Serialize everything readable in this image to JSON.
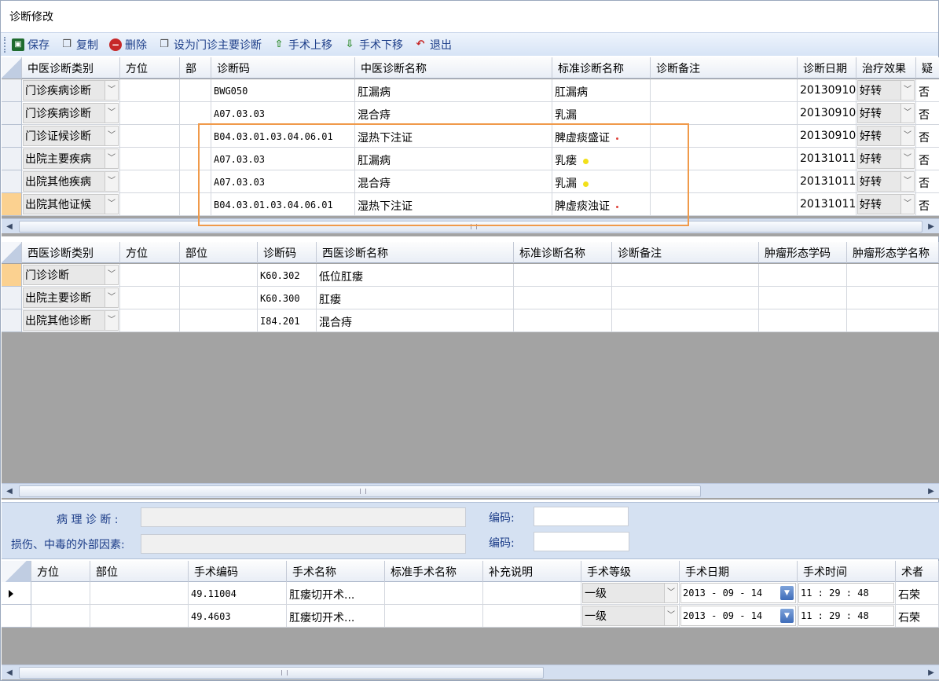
{
  "window": {
    "title": "诊断修改"
  },
  "toolbar": [
    {
      "label": "保存",
      "icon": "save-icon"
    },
    {
      "label": "复制",
      "icon": "copy-icon"
    },
    {
      "label": "删除",
      "icon": "delete-icon"
    },
    {
      "label": "设为门诊主要诊断",
      "icon": "set-primary-icon"
    },
    {
      "label": "手术上移",
      "icon": "arrow-up-icon"
    },
    {
      "label": "手术下移",
      "icon": "arrow-down-icon"
    },
    {
      "label": "退出",
      "icon": "exit-icon"
    }
  ],
  "tcm_grid": {
    "columns": [
      "中医诊断类别",
      "方位",
      "部",
      "诊断码",
      "中医诊断名称",
      "标准诊断名称",
      "诊断备注",
      "诊断日期",
      "治疗效果",
      "疑"
    ],
    "rows": [
      {
        "category": "门诊疾病诊断",
        "position": "",
        "part": "",
        "code": "BWG050",
        "name": "肛漏病",
        "standard": "肛漏病",
        "note": "",
        "date": "20130910",
        "effect": "好转",
        "doubt": "否",
        "dot": ""
      },
      {
        "category": "门诊疾病诊断",
        "position": "",
        "part": "",
        "code": "A07.03.03",
        "name": "混合痔",
        "standard": "乳漏",
        "note": "",
        "date": "20130910",
        "effect": "好转",
        "doubt": "否",
        "dot": ""
      },
      {
        "category": "门诊证候诊断",
        "position": "",
        "part": "",
        "code": "B04.03.01.03.04.06.01",
        "name": "湿热下注证",
        "standard": "脾虚痰盛证",
        "note": "",
        "date": "20130910",
        "effect": "好转",
        "doubt": "否",
        "dot": "#e0423a"
      },
      {
        "category": "出院主要疾病",
        "position": "",
        "part": "",
        "code": "A07.03.03",
        "name": "肛漏病",
        "standard": "乳瘘",
        "note": "",
        "date": "20131011",
        "effect": "好转",
        "doubt": "否",
        "dot": "#f2e01a"
      },
      {
        "category": "出院其他疾病",
        "position": "",
        "part": "",
        "code": "A07.03.03",
        "name": "混合痔",
        "standard": "乳漏",
        "note": "",
        "date": "20131011",
        "effect": "好转",
        "doubt": "否",
        "dot": "#f2e01a"
      },
      {
        "category": "出院其他证候",
        "position": "",
        "part": "",
        "code": "B04.03.01.03.04.06.01",
        "name": "湿热下注证",
        "standard": "脾虚痰浊证",
        "note": "",
        "date": "20131011",
        "effect": "好转",
        "doubt": "否",
        "dot": "#e0423a"
      }
    ]
  },
  "wm_grid": {
    "columns": [
      "西医诊断类别",
      "方位",
      "部位",
      "诊断码",
      "西医诊断名称",
      "标准诊断名称",
      "诊断备注",
      "肿瘤形态学码",
      "肿瘤形态学名称"
    ],
    "rows": [
      {
        "category": "门诊诊断",
        "code": "K60.302",
        "name": "低位肛瘘"
      },
      {
        "category": "出院主要诊断",
        "code": "K60.300",
        "name": "肛瘘"
      },
      {
        "category": "出院其他诊断",
        "code": "I84.201",
        "name": "混合痔"
      }
    ]
  },
  "panel": {
    "pathology_label": "病 理 诊 断 :",
    "injury_label": "损伤、中毒的外部因素:",
    "code_label_1": "编码:",
    "code_label_2": "编码:"
  },
  "surgery_grid": {
    "columns": [
      "方位",
      "部位",
      "手术编码",
      "手术名称",
      "标准手术名称",
      "补充说明",
      "手术等级",
      "手术日期",
      "手术时间",
      "术者"
    ],
    "rows": [
      {
        "code": "49.11004",
        "name": "肛瘘切开术...",
        "level": "一级",
        "date": "2013 - 09 - 14",
        "time": "11 : 29 : 48",
        "surgeon": "石荣"
      },
      {
        "code": "49.4603",
        "name": "肛瘘切开术...",
        "level": "一级",
        "date": "2013 - 09 - 14",
        "time": "11 : 29 : 48",
        "surgeon": "石荣"
      }
    ]
  }
}
